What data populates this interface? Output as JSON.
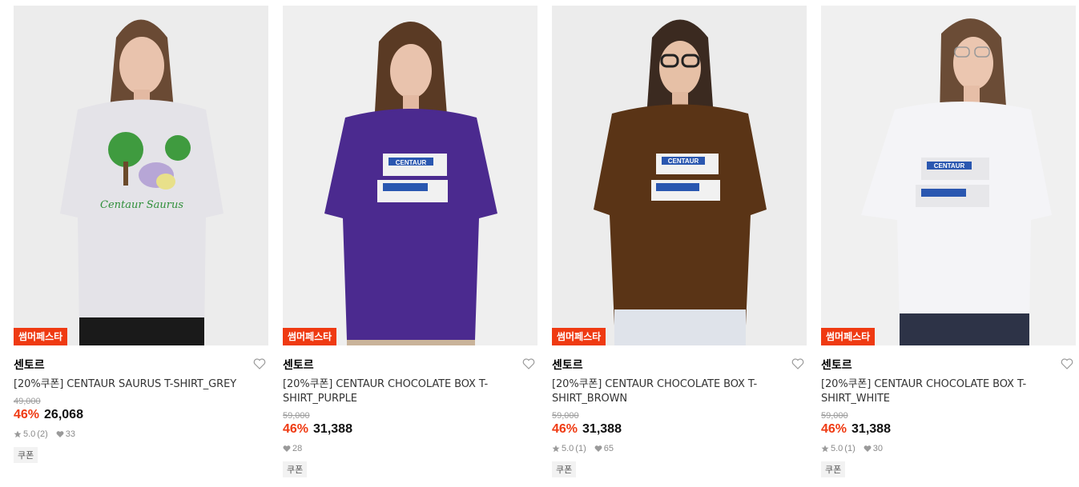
{
  "products": [
    {
      "promo_badge": "썸머페스타",
      "brand": "센토르",
      "title": "[20%쿠폰] CENTAUR SAURUS T-SHIRT_GREY",
      "original_price": "49,000",
      "discount": "46%",
      "price": "26,068",
      "rating": "5.0",
      "review_count": "(2)",
      "likes": "33",
      "coupon_label": "쿠폰",
      "shirt_color": "#e4e3e8",
      "print_text": "Centaur Saurus"
    },
    {
      "promo_badge": "썸머페스타",
      "brand": "센토르",
      "title": "[20%쿠폰] CENTAUR CHOCOLATE BOX T-SHIRT_PURPLE",
      "original_price": "59,000",
      "discount": "46%",
      "price": "31,388",
      "rating": "",
      "review_count": "",
      "likes": "28",
      "coupon_label": "쿠폰",
      "shirt_color": "#4b2a8f",
      "print_text": "CENTAUR"
    },
    {
      "promo_badge": "썸머페스타",
      "brand": "센토르",
      "title": "[20%쿠폰] CENTAUR CHOCOLATE BOX T-SHIRT_BROWN",
      "original_price": "59,000",
      "discount": "46%",
      "price": "31,388",
      "rating": "5.0",
      "review_count": "(1)",
      "likes": "65",
      "coupon_label": "쿠폰",
      "shirt_color": "#5a3416",
      "print_text": "CENTAUR"
    },
    {
      "promo_badge": "썸머페스타",
      "brand": "센토르",
      "title": "[20%쿠폰] CENTAUR CHOCOLATE BOX T-SHIRT_WHITE",
      "original_price": "59,000",
      "discount": "46%",
      "price": "31,388",
      "rating": "5.0",
      "review_count": "(1)",
      "likes": "30",
      "coupon_label": "쿠폰",
      "shirt_color": "#f4f4f7",
      "print_text": "CENTAUR"
    }
  ],
  "colors": {
    "accent": "#ef3a12",
    "strike": "#9a9a9a",
    "meta": "#8a8a8a"
  }
}
